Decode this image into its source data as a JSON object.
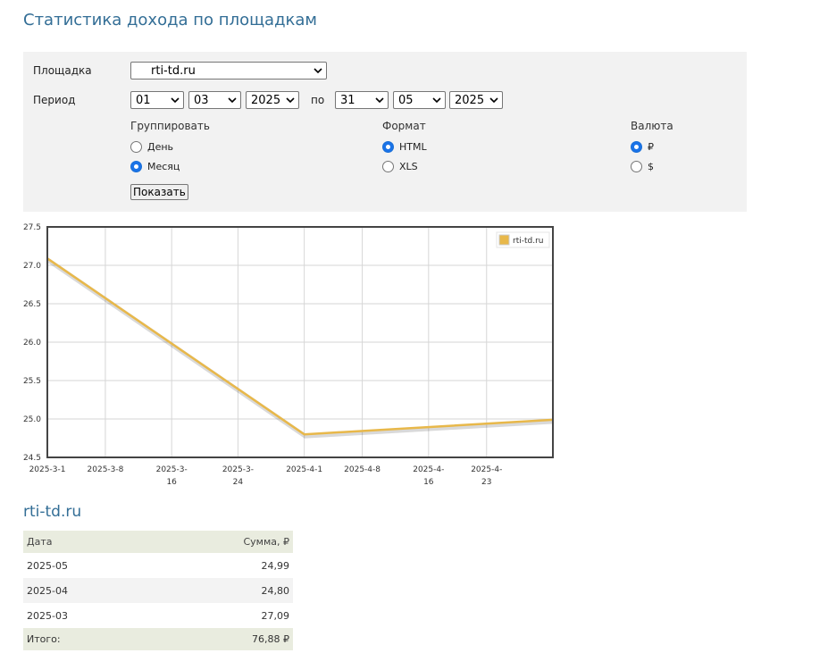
{
  "page": {
    "title": "Статистика дохода по площадкам"
  },
  "filters": {
    "site_label": "Площадка",
    "site_value": "rti-td.ru",
    "period_label": "Период",
    "period_from": {
      "day": "01",
      "month": "03",
      "year": "2025"
    },
    "period_to_word": "по",
    "period_to": {
      "day": "31",
      "month": "05",
      "year": "2025"
    },
    "group": {
      "title": "Группировать",
      "options": [
        {
          "label": "День",
          "checked": false
        },
        {
          "label": "Месяц",
          "checked": true
        }
      ]
    },
    "format": {
      "title": "Формат",
      "options": [
        {
          "label": "HTML",
          "checked": true
        },
        {
          "label": "XLS",
          "checked": false
        }
      ]
    },
    "currency": {
      "title": "Валюта",
      "options": [
        {
          "label": "₽",
          "checked": true
        },
        {
          "label": "$",
          "checked": false
        }
      ]
    },
    "show_button": "Показать"
  },
  "chart_data": {
    "type": "line",
    "title": "",
    "xlabel": "",
    "ylabel": "",
    "x_ticks": [
      "2025-3-1",
      "2025-3-8",
      "2025-3-16",
      "2025-3-24",
      "2025-4-1",
      "2025-4-8",
      "2025-4-16",
      "2025-4-23"
    ],
    "y_ticks": [
      "24.5",
      "25.0",
      "25.5",
      "26.0",
      "26.5",
      "27.0",
      "27.5"
    ],
    "ylim": [
      24.5,
      27.5
    ],
    "xlim": [
      "2025-03-01",
      "2025-05-01"
    ],
    "grid": true,
    "legend_position": "top-right",
    "series": [
      {
        "name": "rti-td.ru",
        "color": "#e8b84a",
        "points": [
          {
            "x": "2025-03-01",
            "y": 27.09
          },
          {
            "x": "2025-04-01",
            "y": 24.8
          },
          {
            "x": "2025-05-01",
            "y": 24.99
          }
        ]
      }
    ]
  },
  "stats": {
    "site_title": "rti-td.ru",
    "headers": {
      "date": "Дата",
      "sum": "Сумма, ₽"
    },
    "rows": [
      {
        "date": "2025-05",
        "sum": "24,99"
      },
      {
        "date": "2025-04",
        "sum": "24,80"
      },
      {
        "date": "2025-03",
        "sum": "27,09"
      }
    ],
    "total_label": "Итого:",
    "total_value": "76,88 ₽"
  },
  "colors": {
    "title": "#336e96",
    "panel_bg": "#f2f2f2",
    "radio_checked": "#1a73e8",
    "table_header_bg": "#e9ecdf"
  }
}
